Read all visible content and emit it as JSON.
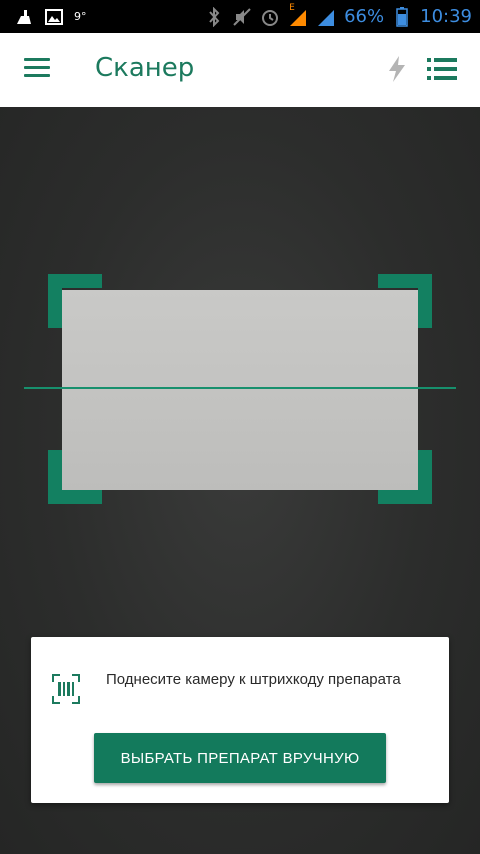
{
  "status_bar": {
    "signal_label": "E",
    "temperature": "9°",
    "battery": "66%",
    "time": "10:39"
  },
  "app_bar": {
    "title": "Сканер"
  },
  "card": {
    "hint": "Поднесите камеру к штрихкоду препарата",
    "button_label": "ВЫБРАТЬ ПРЕПАРАТ ВРУЧНУЮ"
  },
  "colors": {
    "accent": "#1c7a5e",
    "frame": "#138061",
    "scanline": "#17906d"
  }
}
